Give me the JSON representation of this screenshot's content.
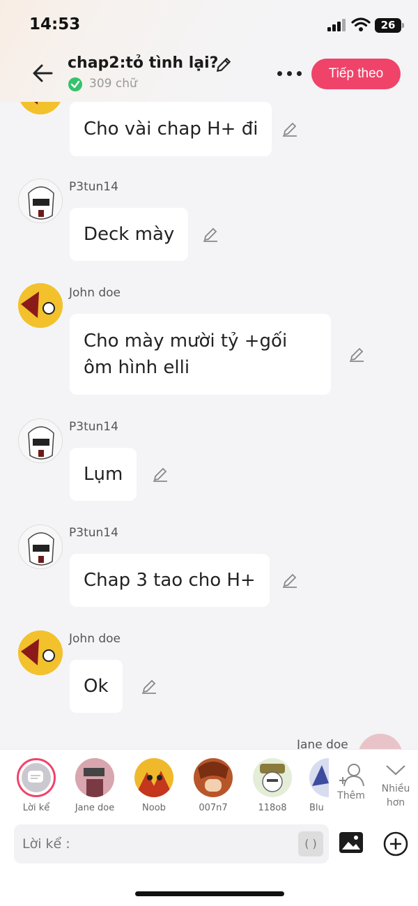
{
  "status_bar": {
    "time": "14:53",
    "battery": "26"
  },
  "header": {
    "title": "chap2:tỏ tình lại?",
    "word_count": "309 chữ",
    "next_label": "Tiếp theo"
  },
  "messages": [
    {
      "user": "",
      "text": "Cho vài chap H+ đi"
    },
    {
      "user": "P3tun14",
      "text": "Deck mày"
    },
    {
      "user": "John doe",
      "text": "Cho mày mười tỷ +gối ôm hình elli"
    },
    {
      "user": "P3tun14",
      "text": "Lụm"
    },
    {
      "user": "P3tun14",
      "text": "Chap 3 tao cho H+"
    },
    {
      "user": "John doe",
      "text": "Ok"
    },
    {
      "user": "Jane doe",
      "text": ""
    }
  ],
  "characters": [
    {
      "name": "Lời kể"
    },
    {
      "name": "Jane doe"
    },
    {
      "name": "Noob"
    },
    {
      "name": "007n7"
    },
    {
      "name": "118o8"
    },
    {
      "name": "Blu"
    }
  ],
  "char_actions": {
    "add_label": "Thêm",
    "more_label": "Nhiều hơn"
  },
  "composer": {
    "placeholder": "Lời kể :",
    "paren_label": "( )"
  },
  "colors": {
    "accent": "#f0436a",
    "check": "#36c26b"
  }
}
